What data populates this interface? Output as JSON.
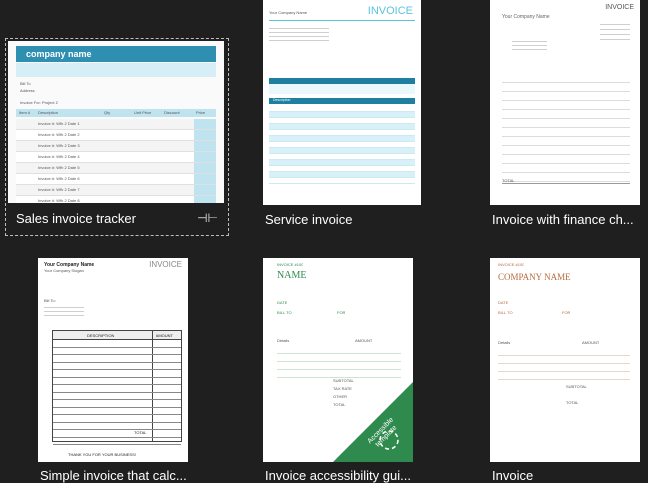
{
  "templates": [
    {
      "caption": "Sales invoice tracker",
      "pinned": true,
      "header": "company name",
      "bill_to": "Bill To",
      "address": "Address",
      "invoice_for": "Invoice For: Project 2",
      "columns": [
        "Item #",
        "Description",
        "Qty",
        "Unit Price",
        "Discount",
        "Price"
      ],
      "rows": [
        "Invoice #: Wfh 2 Date 1",
        "Invoice #: Wfh 2 Date 2",
        "Invoice #: Wfh 2 Date 3",
        "Invoice #: Wfh 2 Date 4",
        "Invoice #: Wfh 2 Date 5",
        "Invoice #: Wfh 2 Date 6",
        "Invoice #: Wfh 2 Date 7",
        "Invoice #: Wfh 2 Date 8"
      ],
      "accent": "#2e8fb0"
    },
    {
      "caption": "Service invoice",
      "title": "INVOICE",
      "company": "Your Company Name",
      "description": "Description",
      "accent": "#5bc4dd"
    },
    {
      "caption": "Invoice with finance ch...",
      "title": "INVOICE",
      "company": "Your Company Name",
      "total": "TOTAL"
    },
    {
      "caption": "Simple invoice that calc...",
      "title": "INVOICE",
      "company": "Your Company Name",
      "slogan": "Your Company Slogan",
      "bill_to": "Bill To:",
      "columns": [
        "DESCRIPTION",
        "AMOUNT"
      ],
      "total": "TOTAL",
      "thanks": "THANK YOU FOR YOUR BUSINESS!"
    },
    {
      "caption": "Invoice accessibility gui...",
      "invoice_no": "INVOICE #100",
      "name": "NAME",
      "date": "DATE",
      "bill_to": "BILL TO",
      "for": "FOR",
      "details": "Details",
      "amount": "AMOUNT",
      "subtotal": "SUBTOTAL",
      "tax_rate": "TAX RATE",
      "other": "OTHER",
      "total": "TOTAL",
      "badge": "Accessible template",
      "accent": "#2f8a4e"
    },
    {
      "caption": "Invoice",
      "invoice_no": "INVOICE #100",
      "company": "COMPANY NAME",
      "date": "DATE",
      "bill_to": "BILL TO",
      "for": "FOR",
      "details": "Details",
      "amount": "AMOUNT",
      "subtotal": "SUBTOTAL",
      "total": "TOTAL",
      "accent": "#b86b3d"
    }
  ]
}
